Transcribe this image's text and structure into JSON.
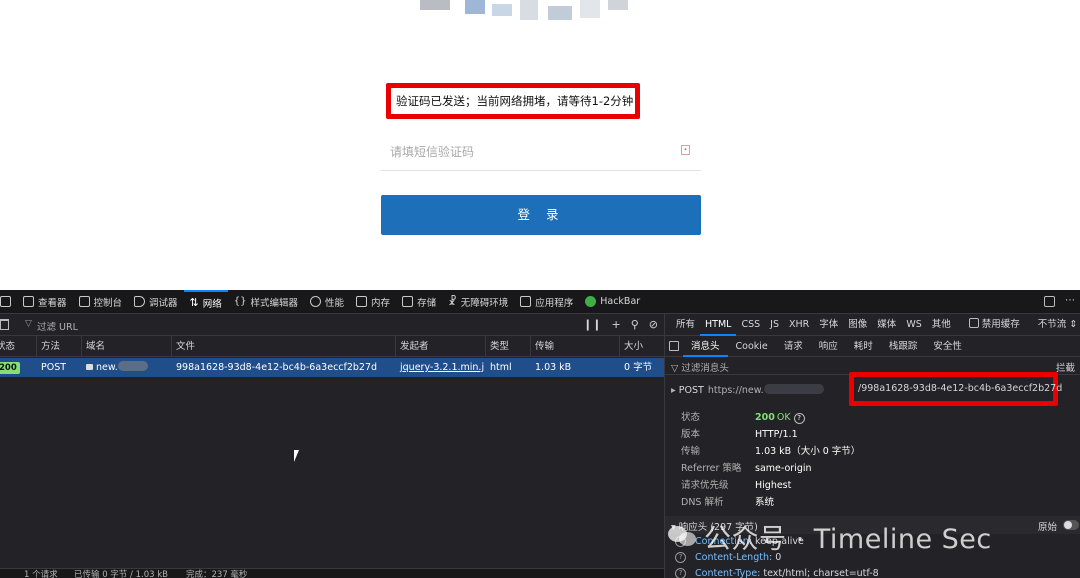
{
  "webpage": {
    "notice": "验证码已发送；当前网络拥堵，请等待1-2分钟",
    "sms_placeholder": "请填短信验证码",
    "login_button": "登 录"
  },
  "devtools": {
    "tools": [
      {
        "name": "inspector",
        "label": "查看器"
      },
      {
        "name": "console",
        "label": "控制台"
      },
      {
        "name": "debugger",
        "label": "调试器"
      },
      {
        "name": "network",
        "label": "网络",
        "active": true
      },
      {
        "name": "style-editor",
        "label": "样式编辑器"
      },
      {
        "name": "performance",
        "label": "性能"
      },
      {
        "name": "memory",
        "label": "内存"
      },
      {
        "name": "storage",
        "label": "存储"
      },
      {
        "name": "accessibility",
        "label": "无障碍环境"
      },
      {
        "name": "application",
        "label": "应用程序"
      },
      {
        "name": "hackbar",
        "label": "HackBar"
      }
    ],
    "filter_url": "过滤 URL",
    "type_filters": [
      "所有",
      "HTML",
      "CSS",
      "JS",
      "XHR",
      "字体",
      "图像",
      "媒体",
      "WS",
      "其他"
    ],
    "active_type": "HTML",
    "disable_cache": "禁用缓存",
    "throttle": "不节流",
    "columns": [
      "状态",
      "方法",
      "域名",
      "文件",
      "发起者",
      "类型",
      "传输",
      "大小"
    ],
    "request": {
      "status": "200",
      "method": "POST",
      "domain": "new.",
      "file": "998a1628-93d8-4e12-bc4b-6a3eccf2b27d",
      "initiator": "jquery-3.2.1.min.j...",
      "type": "html",
      "transferred": "1.03 kB",
      "size": "0 字节"
    },
    "statusbar": {
      "requests": "1 个请求",
      "transferred": "已传输 0 字节 / 1.03 kB",
      "finish": "完成：237 毫秒"
    },
    "detail_tabs": [
      "消息头",
      "Cookie",
      "请求",
      "响应",
      "耗时",
      "栈跟踪",
      "安全性"
    ],
    "filter_headers": "过滤消息头",
    "block": "拦截",
    "post_label": "POST",
    "post_url_prefix": "https://new.",
    "post_url_path": "/998a1628-93d8-4e12-bc4b-6a3eccf2b27d",
    "summary": [
      {
        "k": "状态",
        "v": "OK"
      },
      {
        "k": "版本",
        "v": "HTTP/1.1"
      },
      {
        "k": "传输",
        "v": "1.03 kB（大小 0 字节）"
      },
      {
        "k": "Referrer 策略",
        "v": "same-origin"
      },
      {
        "k": "请求优先级",
        "v": "Highest"
      },
      {
        "k": "DNS 解析",
        "v": "系统"
      }
    ],
    "status_code": "200",
    "response_headers_label": "响应头 (297 字节)",
    "raw": "原始",
    "headers": [
      {
        "k": "Connection:",
        "v": "keep-alive"
      },
      {
        "k": "Content-Length:",
        "v": "0"
      },
      {
        "k": "Content-Type:",
        "v": "text/html; charset=utf-8"
      }
    ]
  },
  "watermark": "公众号 · Timeline Sec"
}
